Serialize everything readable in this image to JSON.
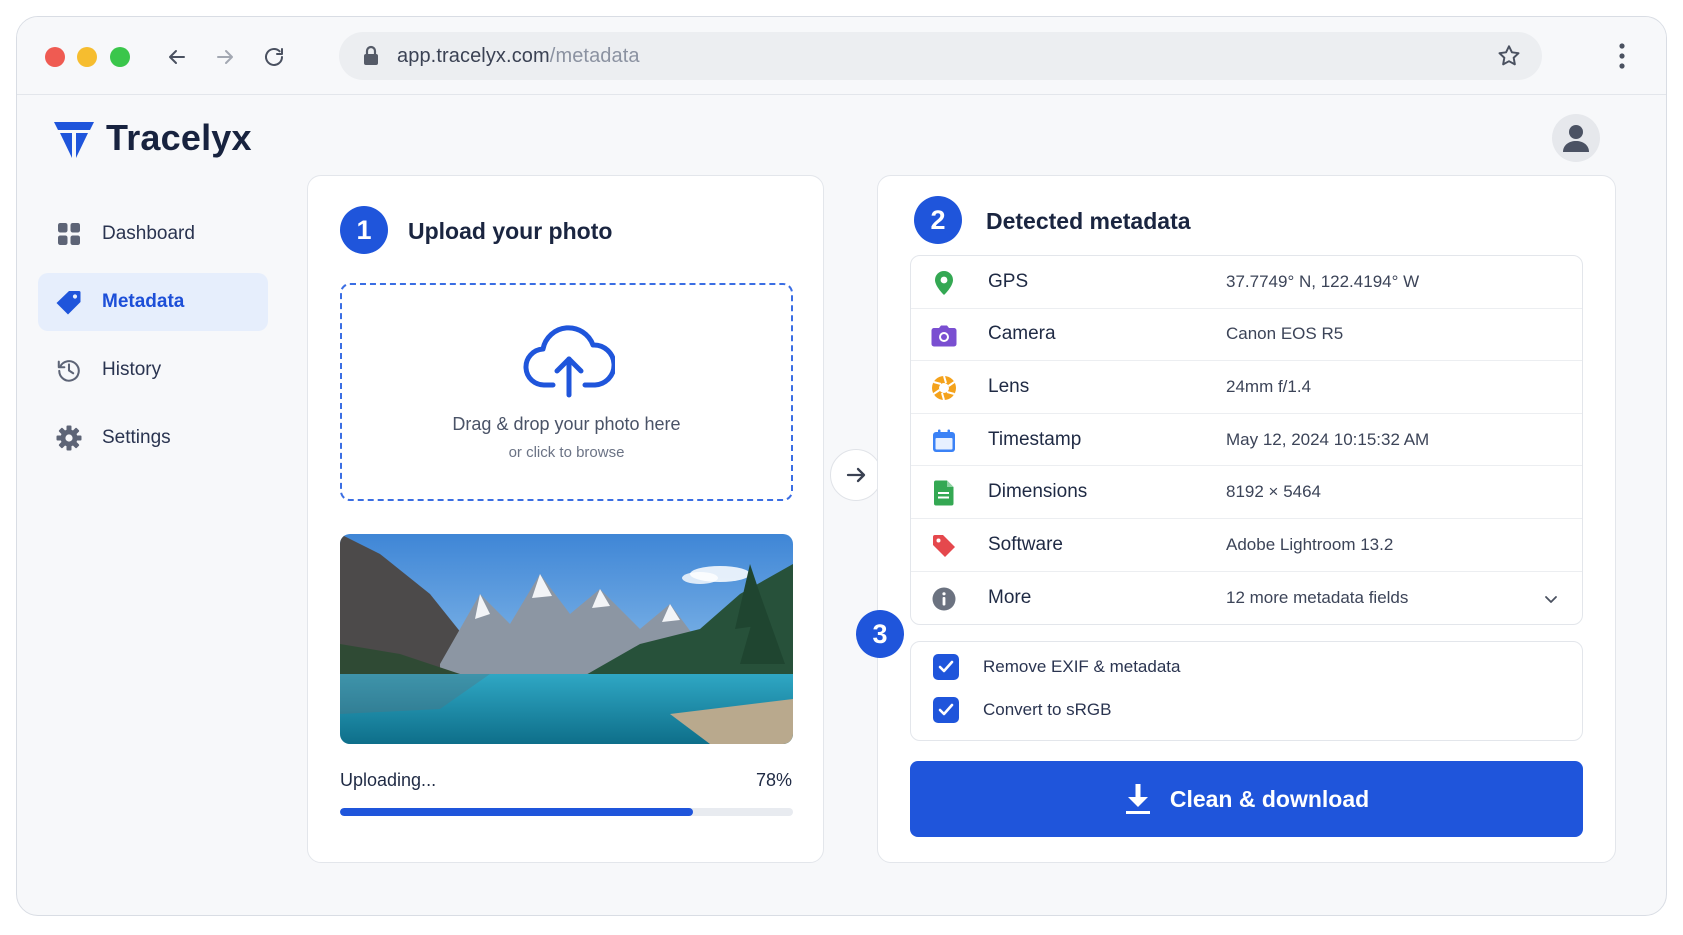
{
  "browser": {
    "url_host": "app.tracelyx.com",
    "url_path": "/metadata"
  },
  "app": {
    "name": "Tracelyx"
  },
  "sidebar": {
    "items": [
      {
        "label": "Dashboard",
        "icon": "dashboard-grid-icon",
        "active": false
      },
      {
        "label": "Metadata",
        "icon": "tag-icon",
        "active": true
      },
      {
        "label": "History",
        "icon": "history-clock-icon",
        "active": false
      },
      {
        "label": "Settings",
        "icon": "gear-icon",
        "active": false
      }
    ]
  },
  "upload": {
    "step": "1",
    "title": "Upload your photo",
    "drop_text": "Drag & drop your photo here",
    "browse_text": "or click to browse",
    "status_label": "Uploading...",
    "percent_text": "78%",
    "progress": 0.78
  },
  "metadata": {
    "step": "2",
    "title": "Detected metadata",
    "rows": [
      {
        "key": "GPS",
        "value": "37.7749° N, 122.4194° W",
        "icon": "map-pin-icon",
        "color": "#34a853"
      },
      {
        "key": "Camera",
        "value": "Canon EOS R5",
        "icon": "camera-icon",
        "color": "#7a4fd1"
      },
      {
        "key": "Lens",
        "value": "24mm f/1.4",
        "icon": "aperture-icon",
        "color": "#f4a21b"
      },
      {
        "key": "Timestamp",
        "value": "May 12, 2024 10:15:32 AM",
        "icon": "calendar-icon",
        "color": "#3b82f6"
      },
      {
        "key": "Dimensions",
        "value": "8192 × 5464",
        "icon": "document-icon",
        "color": "#34a853"
      },
      {
        "key": "Software",
        "value": "Adobe Lightroom 13.2",
        "icon": "tag-icon",
        "color": "#e5484d"
      },
      {
        "key": "More",
        "value": "12 more metadata fields",
        "icon": "info-icon",
        "color": "#6b7280"
      }
    ]
  },
  "options": {
    "step": "3",
    "items": [
      {
        "label": "Remove EXIF & metadata",
        "checked": true
      },
      {
        "label": "Convert to sRGB",
        "checked": true
      }
    ]
  },
  "actions": {
    "download_label": "Clean & download"
  },
  "colors": {
    "accent": "#1f55db",
    "accent_light": "#e6eefc"
  }
}
